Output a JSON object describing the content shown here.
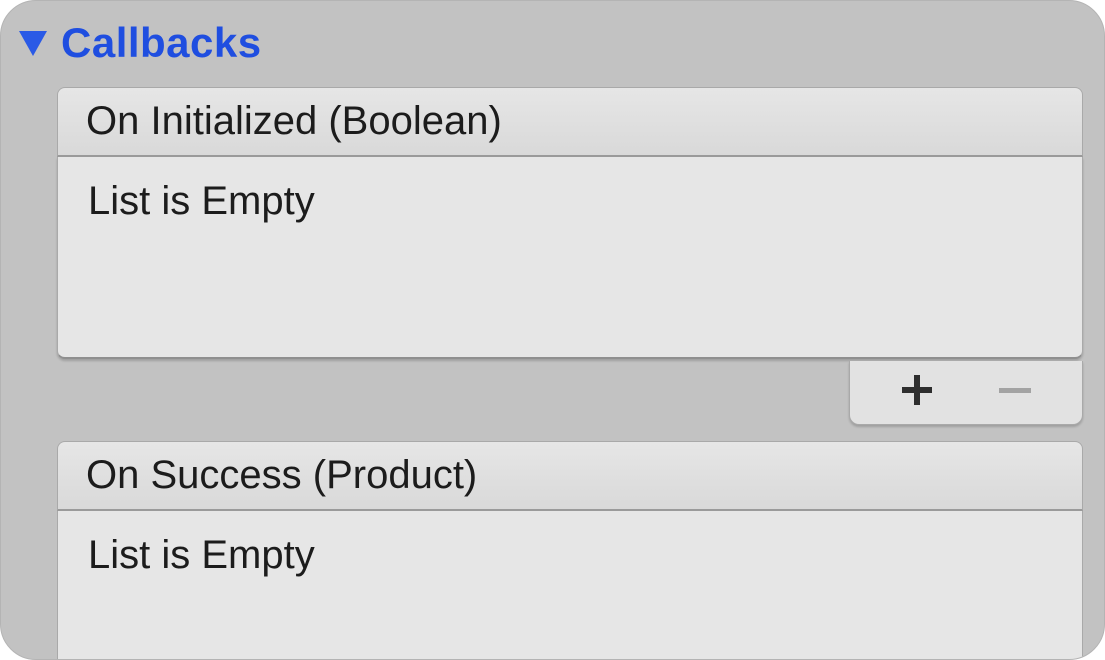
{
  "foldout": {
    "label": "Callbacks",
    "icon": "triangle-down-icon",
    "color": "#1f4ee0",
    "expanded": true
  },
  "events": [
    {
      "header": "On Initialized (Boolean)",
      "body": "List is Empty"
    },
    {
      "header": "On Success (Product)",
      "body": "List is Empty"
    }
  ],
  "list_footer": {
    "add_icon": "plus-icon",
    "remove_icon": "minus-icon"
  }
}
